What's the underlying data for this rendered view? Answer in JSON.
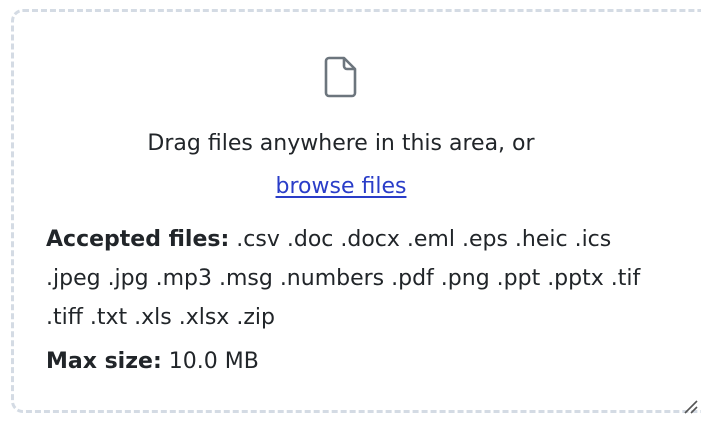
{
  "dropzone": {
    "icon": "file-icon",
    "drag_text": "Drag files anywhere in this area, or",
    "browse_label": "browse files",
    "accepted_label": "Accepted files:",
    "accepted_types": ".csv .doc .docx .eml .eps .heic .ics .jpeg .jpg .mp3 .msg .numbers .pdf .png .ppt .pptx .tif .tiff .txt .xls .xlsx .zip",
    "max_size_label": "Max size:",
    "max_size_value": "10.0 MB"
  },
  "colors": {
    "border": "#d4dbe4",
    "text": "#212529",
    "link": "#2a3dc8",
    "icon": "#6c757d"
  },
  "resize_handle_icon": "resize-grip-icon"
}
